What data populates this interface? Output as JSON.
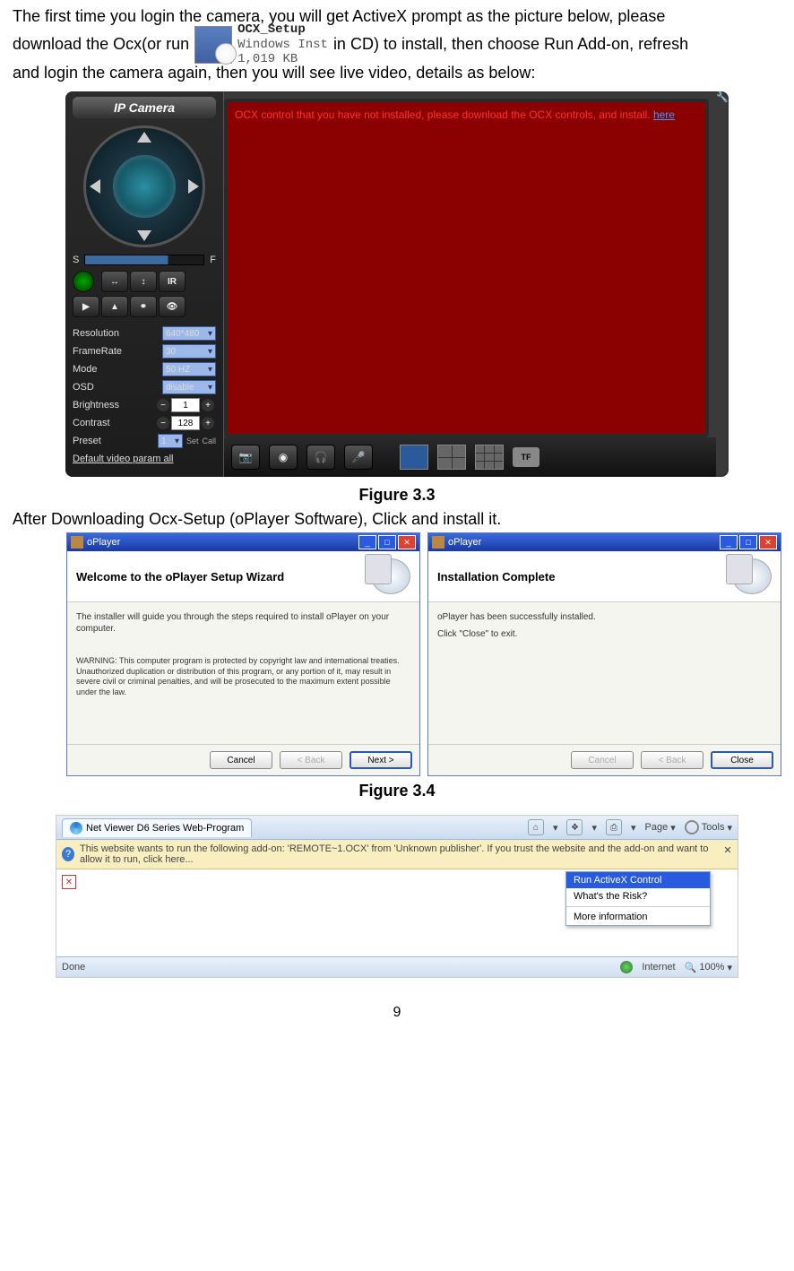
{
  "intro": {
    "line1": "The first time you login the camera, you will get ActiveX prompt as the picture below, please",
    "line2a": "download the Ocx(or run",
    "line2b": "in CD) to install, then choose Run Add-on, refresh",
    "line3": "and login the camera again, then you will see live video, details as below:",
    "setup_name": "OCX_Setup",
    "setup_sub1": "Windows Inst",
    "setup_sub2": "1,019 KB"
  },
  "fig33_caption": "Figure 3.3",
  "ipcam": {
    "logo": "IP Camera",
    "s": "S",
    "f": "F",
    "ir": "IR",
    "resolution_label": "Resolution",
    "resolution_val": "640*480",
    "framerate_label": "FrameRate",
    "framerate_val": "30",
    "mode_label": "Mode",
    "mode_val": "50 HZ",
    "osd_label": "OSD",
    "osd_val": "disable",
    "brightness_label": "Brightness",
    "brightness_val": "1",
    "contrast_label": "Contrast",
    "contrast_val": "128",
    "preset_label": "Preset",
    "preset_val": "1",
    "preset_set": "Set",
    "preset_call": "Call",
    "default_link": "Default video param all",
    "ocx_msg1": "OCX control that you have not installed, please download the OCX controls, and install.",
    "ocx_here": "here",
    "tf": "TF"
  },
  "after_text": "After Downloading Ocx-Setup (oPlayer Software), Click and install it.",
  "fig34_caption": "Figure 3.4",
  "inst1": {
    "title": "oPlayer",
    "header": "Welcome to the oPlayer Setup Wizard",
    "body": "The installer will guide you through the steps required to install oPlayer on your computer.",
    "warning": "WARNING: This computer program is protected by copyright law and international treaties. Unauthorized duplication or distribution of this program, or any portion of it, may result in severe civil or criminal penalties, and will be prosecuted to the maximum extent possible under the law.",
    "btn_cancel": "Cancel",
    "btn_back": "< Back",
    "btn_next": "Next >"
  },
  "inst2": {
    "title": "oPlayer",
    "header": "Installation Complete",
    "body1": "oPlayer has been successfully installed.",
    "body2": "Click \"Close\" to exit.",
    "btn_cancel": "Cancel",
    "btn_back": "< Back",
    "btn_close": "Close"
  },
  "ie": {
    "tab_title": "Net Viewer D6 Series Web-Program",
    "page_label": "Page",
    "tools_label": "Tools",
    "info_text": "This website wants to run the following add-on: 'REMOTE~1.OCX' from 'Unknown publisher'. If you trust the website and the add-on and want to allow it to run, click here...",
    "menu_run": "Run ActiveX Control",
    "menu_risk": "What's the Risk?",
    "menu_more": "More information",
    "done": "Done",
    "internet": "Internet",
    "zoom": "100%"
  },
  "page_number": "9"
}
